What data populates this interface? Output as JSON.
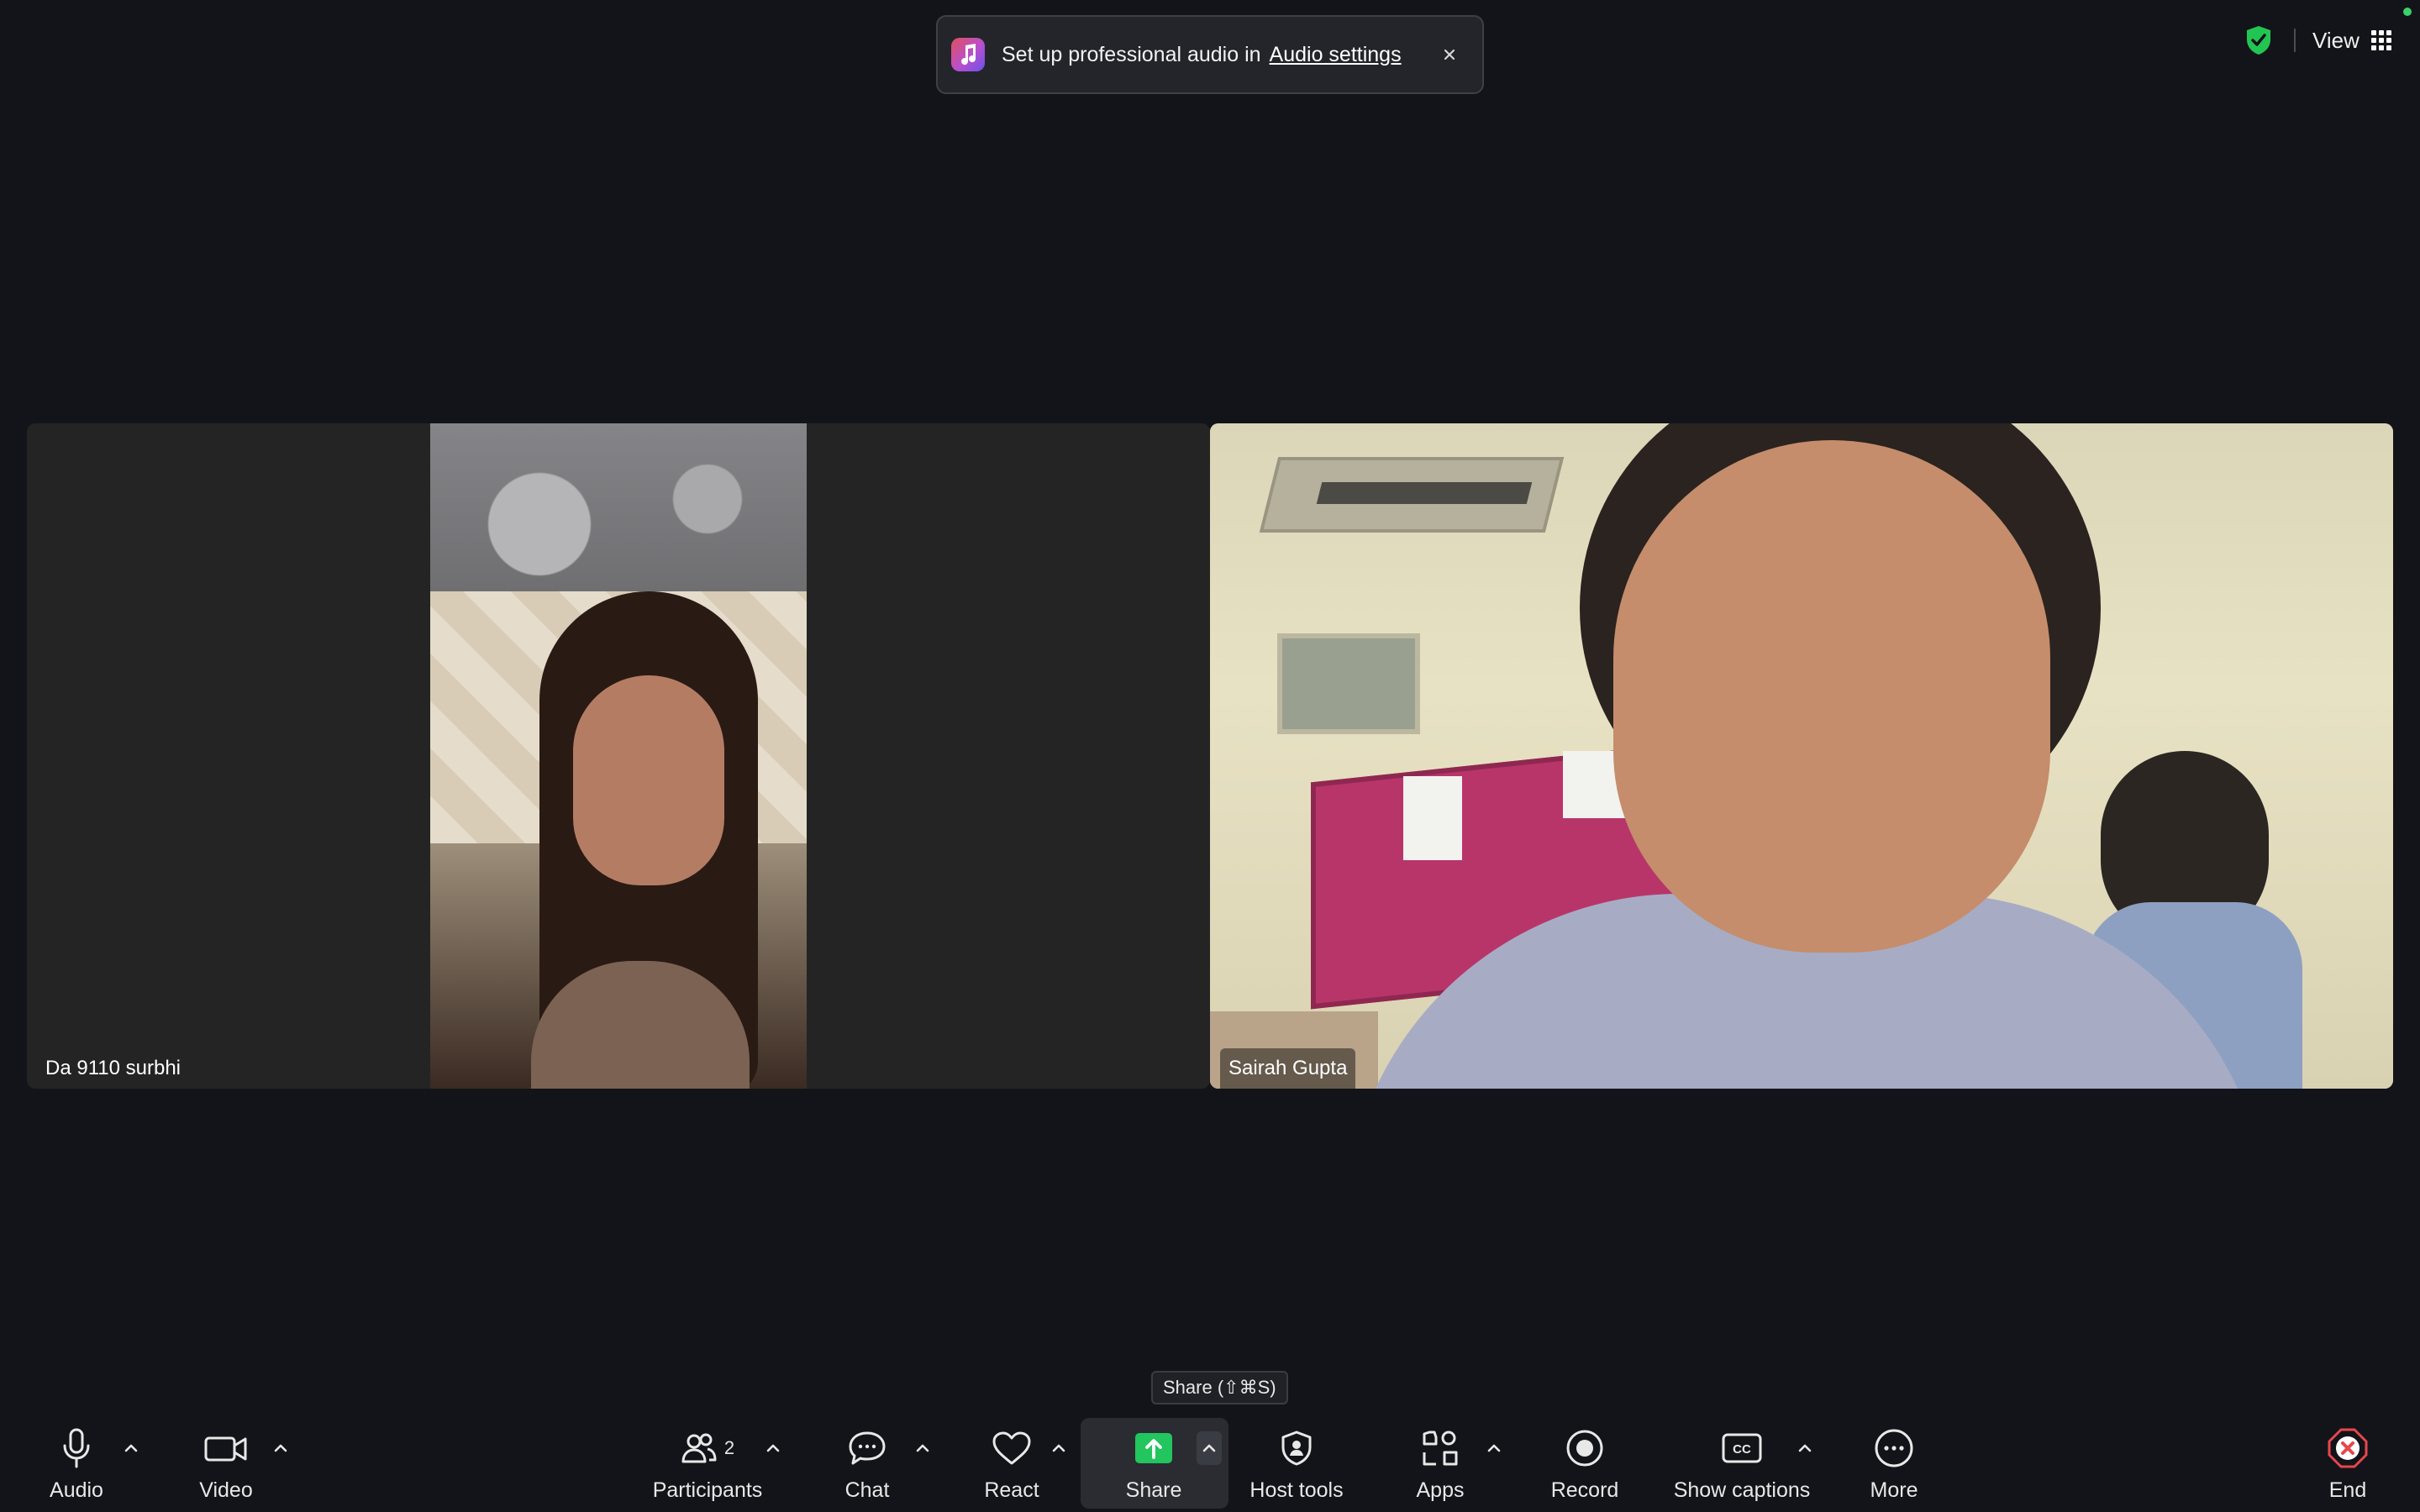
{
  "banner": {
    "text": "Set up professional audio in",
    "link": "Audio settings",
    "close": "×"
  },
  "topbar": {
    "view_label": "View",
    "security_color": "#23c552"
  },
  "participants": [
    {
      "name": "Da 9110 surbhi"
    },
    {
      "name": "Sairah Gupta"
    }
  ],
  "tooltip": {
    "text": "Share (⇧⌘S)"
  },
  "toolbar": {
    "audio": "Audio",
    "video": "Video",
    "participants": "Participants",
    "participants_count": "2",
    "chat": "Chat",
    "react": "React",
    "share": "Share",
    "host_tools": "Host tools",
    "apps": "Apps",
    "record": "Record",
    "show_captions": "Show captions",
    "more": "More",
    "end": "End",
    "share_color": "#22c55e",
    "end_color": "#e5484d"
  }
}
